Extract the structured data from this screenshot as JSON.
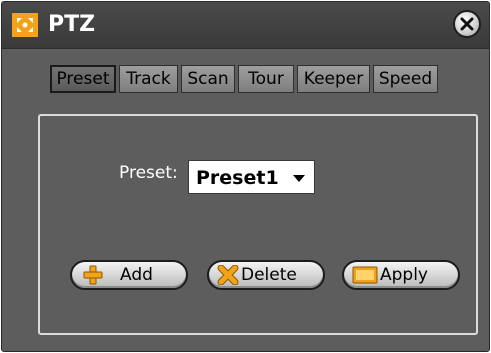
{
  "window": {
    "title": "PTZ",
    "icons": {
      "app": "ptz-app-icon",
      "close": "close-icon"
    }
  },
  "tabs": [
    {
      "label": "Preset",
      "active": true
    },
    {
      "label": "Track",
      "active": false
    },
    {
      "label": "Scan",
      "active": false
    },
    {
      "label": "Tour",
      "active": false
    },
    {
      "label": "Keeper",
      "active": false
    },
    {
      "label": "Speed",
      "active": false
    }
  ],
  "preset": {
    "label": "Preset:",
    "selected": "Preset1"
  },
  "buttons": {
    "add": {
      "label": "Add",
      "icon": "plus-icon"
    },
    "delete": {
      "label": "Delete",
      "icon": "x-icon"
    },
    "apply": {
      "label": "Apply",
      "icon": "monitor-icon"
    }
  },
  "colors": {
    "window_bg": "#5d5d5d",
    "titlebar_bg": "#3a3a3a",
    "icon_orange": "#f2a21b",
    "tab_bg": "#8f8f8f",
    "panel_border": "#dcdcdc"
  }
}
